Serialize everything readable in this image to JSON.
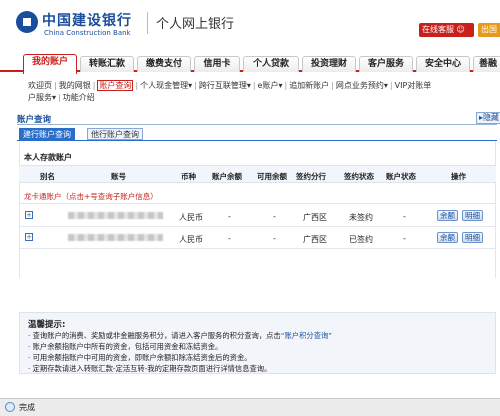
{
  "header": {
    "bank_name_cn": "中国建设银行",
    "bank_name_en": "China Construction Bank",
    "portal_title": "个人网上银行",
    "online_service": "在线客服",
    "exit_label": "出国"
  },
  "tabs": [
    "我的账户",
    "转账汇款",
    "缴费支付",
    "信用卡",
    "个人贷款",
    "投资理财",
    "客户服务",
    "安全中心",
    "善融"
  ],
  "active_tab": 0,
  "subnav": [
    "欢迎页",
    "我的网银",
    "账户查询",
    "个人现金管理",
    "跨行互联管理",
    "e账户",
    "追加新账户",
    "网点业务预约",
    "VIP对账单",
    "户服务",
    "功能介绍"
  ],
  "subnav_current": 2,
  "section": {
    "title": "账户查询",
    "hide_label": "隐藏",
    "subtabs": [
      "建行账户查询",
      "他行账户查询"
    ],
    "panel_title": "本人存款账户"
  },
  "table": {
    "headers": [
      "别名",
      "账号",
      "币种",
      "账户余额",
      "可用余额",
      "签约分行",
      "签约状态",
      "账户状态",
      "操作"
    ],
    "notice": "龙卡通账户（点击+号查询子账户信息）",
    "rows": [
      {
        "currency": "人民币",
        "balance": "-",
        "available": "-",
        "branch": "广西区",
        "sign_status": "未签约",
        "acct_status": "-",
        "actions": [
          "余额",
          "明细"
        ]
      },
      {
        "currency": "人民币",
        "balance": "-",
        "available": "-",
        "branch": "广西区",
        "sign_status": "已签约",
        "acct_status": "-",
        "actions": [
          "余额",
          "明细"
        ]
      }
    ]
  },
  "tips": {
    "title": "温馨提示:",
    "line1_a": "· 查询账户的消费、奖励或非金融服务积分，请进入客户服务的积分查询，点击",
    "line1_link": "“账户积分查询”",
    "line2": "· 账户余额指账户中所有的资金，包括可用资金和冻结资金。",
    "line3": "· 可用余额指账户中可用的资金，即账户余额扣除冻结资金后的资金。",
    "line4": "· 定期存款请进入转账汇款-定活互转-我的定期存款页面进行详情信息查询。"
  },
  "status": {
    "text": "完成"
  }
}
